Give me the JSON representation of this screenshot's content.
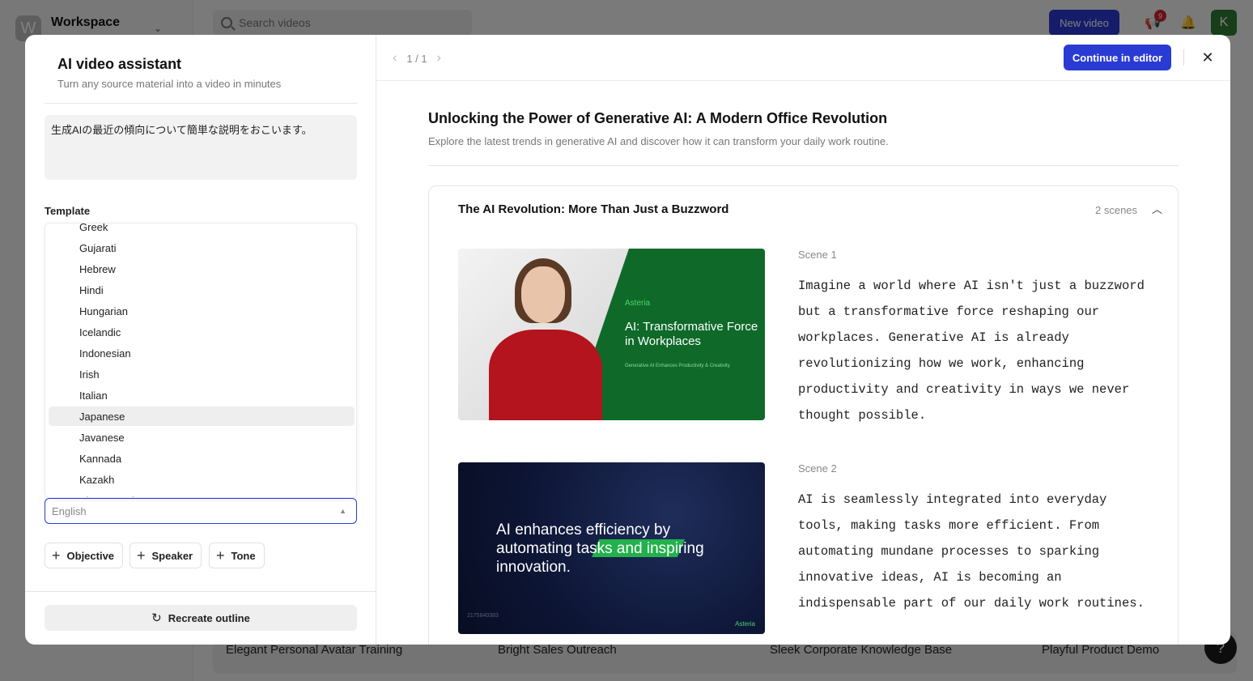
{
  "background": {
    "workspace_initial": "W",
    "workspace_name": "Workspace",
    "search_placeholder": "Search videos",
    "new_video_label": "New video",
    "notification_count": "9",
    "avatar_initial": "K",
    "cards": [
      "Elegant Personal Avatar Training",
      "Bright Sales Outreach",
      "Sleek Corporate Knowledge Base",
      "Playful Product Demo"
    ],
    "help_label": "?"
  },
  "modal": {
    "title": "AI video assistant",
    "subtitle": "Turn any source material into a video in minutes",
    "prompt_text": "生成AIの最近の傾向について簡単な説明をおこいます。",
    "template_label": "Template",
    "languages": [
      "Greek",
      "Gujarati",
      "Hebrew",
      "Hindi",
      "Hungarian",
      "Icelandic",
      "Indonesian",
      "Irish",
      "Italian",
      "Japanese",
      "Javanese",
      "Kannada",
      "Kazakh",
      "Kinyarwanda"
    ],
    "selected_language": "Japanese",
    "language_placeholder": "English",
    "chips": [
      "Objective",
      "Speaker",
      "Tone"
    ],
    "recreate_label": "Recreate outline",
    "pager": "1 / 1",
    "continue_label": "Continue in editor",
    "doc_title": "Unlocking the Power of Generative AI: A Modern Office Revolution",
    "doc_subtitle": "Explore the latest trends in generative AI and discover how it can transform your daily work routine.",
    "section": {
      "title": "The AI Revolution: More Than Just a Buzzword",
      "scene_count": "2 scenes",
      "scenes": [
        {
          "label": "Scene 1",
          "text": "Imagine a world where AI isn't just a buzzword but a transformative force reshaping our workplaces. Generative AI is already revolutionizing how we work, enhancing productivity and creativity in ways we never thought possible.",
          "thumb_brand": "Asteria",
          "thumb_title": "AI: Transformative Force in Workplaces",
          "thumb_caption": "Generative AI Enhances Productivity & Creativity"
        },
        {
          "label": "Scene 2",
          "text": "AI is seamlessly integrated into everyday tools, making tasks more efficient. From automating mundane processes to sparking innovative ideas, AI is becoming an indispensable part of our daily work routines.",
          "thumb_title": "AI enhances efficiency by automating tasks and inspiring innovation.",
          "thumb_code": "2175840383",
          "thumb_brand": "Asteria"
        }
      ]
    }
  },
  "colors": {
    "accent": "#2a3bd4",
    "brand_green": "#0f6a2a",
    "highlight_green": "#22b14c",
    "badge_red": "#d2232a"
  }
}
